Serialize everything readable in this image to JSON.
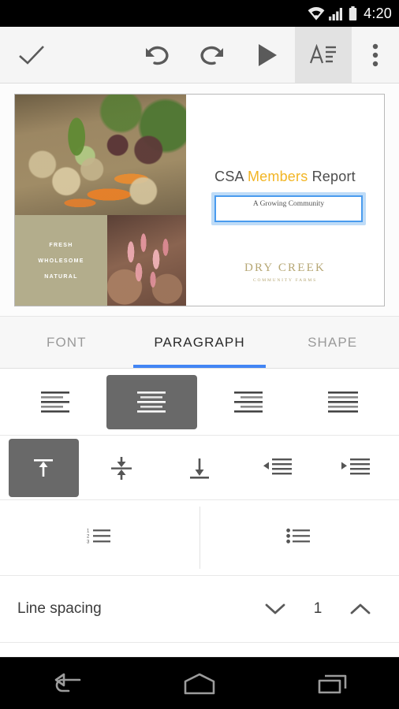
{
  "statusbar": {
    "time": "4:20",
    "icons": [
      "wifi-icon",
      "cellular-signal-icon",
      "battery-icon"
    ]
  },
  "toolbar": {
    "done_label": "done-checkmark",
    "undo_label": "undo",
    "redo_label": "redo",
    "present_label": "present",
    "format_label": "format-text",
    "overflow_label": "more-options",
    "active_item": "format-text",
    "active_bg": "#e2e2e2"
  },
  "slide": {
    "title_before": "CSA ",
    "title_highlight": "Members",
    "title_after": " Report",
    "highlight_color": "#f2b524",
    "textbox_text": "A Growing Community",
    "textbox_selected": true,
    "selection_color": "#4a9bee",
    "tagline": [
      "FRESH",
      "WHOLESOME",
      "NATURAL"
    ],
    "tagline_bg": "#b3ad8c",
    "logo_main": "DRY CREEK",
    "logo_sub": "COMMUNITY FARMS",
    "logo_color": "#b6a774",
    "images": [
      "vegetable-crate-photo",
      "cranberry-beans-photo"
    ]
  },
  "tabs": {
    "items": [
      {
        "label": "FONT",
        "active": false
      },
      {
        "label": "PARAGRAPH",
        "active": true
      },
      {
        "label": "SHAPE",
        "active": false
      }
    ],
    "indicator_color": "#4285f4"
  },
  "paragraph_panel": {
    "alignment": {
      "options": [
        "align-left",
        "align-center",
        "align-right",
        "align-justify"
      ],
      "selected": "align-center"
    },
    "vertical_alignment": {
      "options": [
        "align-top",
        "align-middle",
        "align-bottom",
        "decrease-indent",
        "increase-indent"
      ],
      "selected": "align-top"
    },
    "lists": {
      "options": [
        "numbered-list",
        "bulleted-list"
      ],
      "selected": null
    },
    "line_spacing": {
      "label": "Line spacing",
      "value": "1",
      "decrease_icon": "chevron-down-icon",
      "increase_icon": "chevron-up-icon"
    },
    "selected_bg": "#696969"
  },
  "navbar": {
    "items": [
      "back-button",
      "home-button",
      "recents-button"
    ]
  }
}
